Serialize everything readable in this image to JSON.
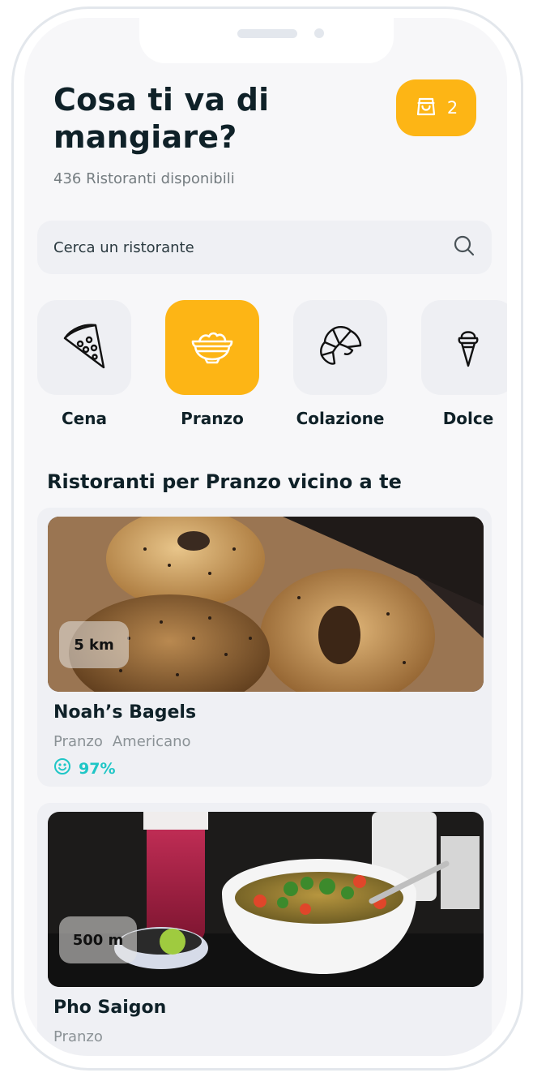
{
  "header": {
    "title": "Cosa ti va di mangiare?",
    "subtitle": "436 Ristoranti disponibili"
  },
  "cart": {
    "icon": "shopping-bag-icon",
    "count": "2"
  },
  "search": {
    "placeholder": "Cerca un ristorante",
    "value": "",
    "icon": "search-icon"
  },
  "categories": [
    {
      "label": "Cena",
      "icon": "pizza-slice-icon",
      "active": false
    },
    {
      "label": "Pranzo",
      "icon": "bowl-icon",
      "active": true
    },
    {
      "label": "Colazione",
      "icon": "croissant-icon",
      "active": false
    },
    {
      "label": "Dolce",
      "icon": "ice-cream-icon",
      "active": false
    }
  ],
  "section": {
    "title": "Ristoranti per Pranzo vicino a te"
  },
  "restaurants": [
    {
      "name": "Noah’s Bagels",
      "distance": "5 km",
      "tags": [
        "Pranzo",
        "Americano"
      ],
      "rating": "97%",
      "rating_icon": "smiley-icon",
      "image": "bagels-photo"
    },
    {
      "name": "Pho Saigon",
      "distance": "500 m",
      "tags": [
        "Pranzo"
      ],
      "image": "pho-soup-photo"
    }
  ],
  "colors": {
    "accent": "#fdb515",
    "rating": "#1fc6c6",
    "background": "#f7f7f9",
    "tile": "#eeeff3"
  }
}
